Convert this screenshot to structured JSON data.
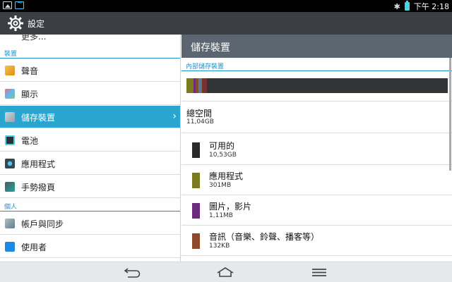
{
  "statusbar": {
    "time": "下午 2:18"
  },
  "actionbar": {
    "title": "設定"
  },
  "left": {
    "truncated_item": "更多...",
    "sections": [
      {
        "label": "裝置"
      },
      {
        "label": "個人"
      }
    ],
    "items": [
      {
        "label": "聲音"
      },
      {
        "label": "顯示"
      },
      {
        "label": "儲存裝置",
        "selected": true
      },
      {
        "label": "電池"
      },
      {
        "label": "應用程式"
      },
      {
        "label": "手勢撥頁"
      },
      {
        "label": "帳戶與同步"
      },
      {
        "label": "使用者"
      }
    ]
  },
  "right": {
    "header": "儲存裝置",
    "section": "內部儲存裝置",
    "usage_bar": [
      {
        "name": "應用程式",
        "color": "#7a7a1e",
        "fraction": 0.027
      },
      {
        "name": "圖片，影片",
        "color": "#6b2d7a",
        "fraction": 0.008
      },
      {
        "name": "音訊",
        "color": "#8b4a2a",
        "fraction": 0.01
      },
      {
        "name": "other-a",
        "color": "#4a7fa8",
        "fraction": 0.008
      },
      {
        "name": "other-b",
        "color": "#5a7f6a",
        "fraction": 0.006
      },
      {
        "name": "other-c",
        "color": "#7a3030",
        "fraction": 0.02
      },
      {
        "name": "可用的",
        "color": "#333436",
        "fraction": 0.921
      }
    ],
    "total": {
      "title": "總空間",
      "value": "11,04GB"
    },
    "items": [
      {
        "title": "可用的",
        "value": "10,53GB",
        "color": "#333436"
      },
      {
        "title": "應用程式",
        "value": "301MB",
        "color": "#7a7a1e"
      },
      {
        "title": "圖片，影片",
        "value": "1,11MB",
        "color": "#6b2d7a"
      },
      {
        "title": "音訊（音樂、鈴聲、播客等）",
        "value": "132KB",
        "color": "#8b4a2a"
      }
    ]
  }
}
